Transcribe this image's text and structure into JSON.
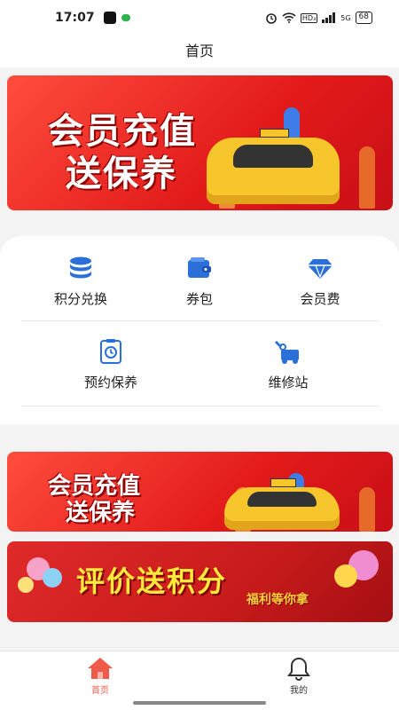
{
  "status_bar": {
    "time": "17:07",
    "network_badge": "HD₃",
    "signal_label": "5G",
    "battery": "68"
  },
  "header": {
    "title": "首页"
  },
  "banners": {
    "top": {
      "line1": "会员充值",
      "line2": "送保养"
    },
    "mid": {
      "line1": "会员充值",
      "line2": "送保养"
    },
    "bottom": {
      "headline": "评价送积分",
      "subline": "福利等你拿"
    }
  },
  "menu": {
    "items": [
      {
        "label": "积分兑换",
        "icon": "database-icon"
      },
      {
        "label": "券包",
        "icon": "wallet-icon"
      },
      {
        "label": "会员费",
        "icon": "diamond-icon"
      },
      {
        "label": "预约保养",
        "icon": "clock-clipboard-icon"
      },
      {
        "label": "维修站",
        "icon": "repair-icon"
      }
    ]
  },
  "bottom_nav": {
    "tabs": [
      {
        "label": "首页",
        "icon": "home-icon",
        "active": true
      },
      {
        "label": "我的",
        "icon": "bell-icon",
        "active": false
      }
    ],
    "active_color": "#f05a4a",
    "inactive_color": "#333333"
  },
  "colors": {
    "accent_blue": "#2b6fd8",
    "banner_red": "#e21a1a"
  }
}
